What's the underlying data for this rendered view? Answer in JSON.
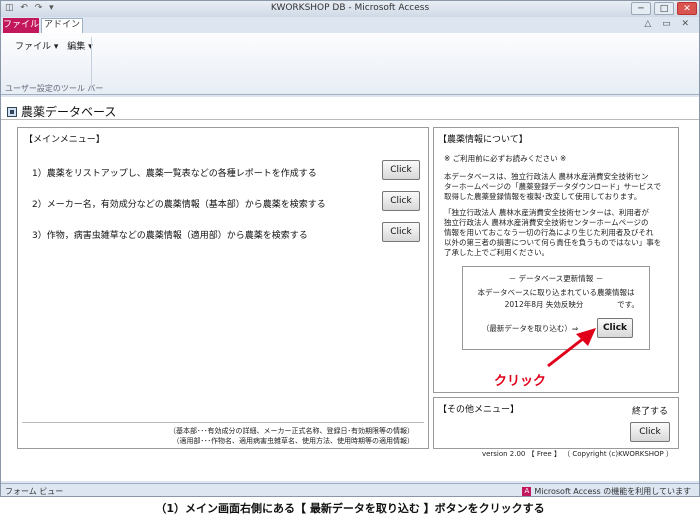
{
  "window": {
    "qa_toolbar": "◫ ↶ ↷ ▾",
    "title": "KWORKSHOP DB - Microsoft Access",
    "ctl": [
      "─",
      "□",
      "✕"
    ]
  },
  "ribbon": {
    "tab_file": "ファイル",
    "tab_addin": "アドイン",
    "right_ctl": "△ ▭ ✕",
    "menus": [
      "ファイル ▾",
      "編集 ▾"
    ],
    "group": "ユーザー設定のツール バー"
  },
  "doc": {
    "title": "農薬データベース"
  },
  "main": {
    "heading": "【メインメニュー】",
    "rows": [
      {
        "text": "1）農薬をリストアップし、農薬一覧表などの各種レポートを作成する",
        "button": "Click"
      },
      {
        "text": "2）メーカー名，有効成分などの農薬情報（基本部）から農薬を検索する",
        "button": "Click"
      },
      {
        "text": "3）作物，病害虫雑草などの農薬情報（適用部）から農薬を検索する",
        "button": "Click"
      }
    ],
    "footnote1": "（基本部･･･有効成分の詳細、メーカー正式名称、登録日･有効期限等の情報）",
    "footnote2": "（適用部･･･作物名、適用病害虫雑草名、使用方法、使用時期等の適用情報）"
  },
  "info": {
    "heading": "【農薬情報について】",
    "notice": "※ ご利用前に必ずお読みください ※",
    "p1": [
      "本データベースは、独立行政法人 農林水産消費安全技術セン",
      "ターホームページの「農薬登録データダウンロード」サービスで",
      "取得した農薬登録情報を複製･改変して使用しております。"
    ],
    "p2": [
      "「独立行政法人 農林水産消費安全技術センターは、利用者が",
      "独立行政法人 農林水産消費安全技術センターホームページの",
      "情報を用いておこなう一切の行為により生じた利用者及びそれ",
      "以外の第三者の損害について何ら責任を負うものではない」事を",
      "了承した上でご利用ください。"
    ],
    "update_title": "－ データベース更新情報 －",
    "update_line1": "本データベースに取り込まれている農薬情報は",
    "update_date": "2012年8月 失効反映分",
    "update_suffix": "です。",
    "import_label": "（最新データを取り込む）⇒",
    "import_button": "Click"
  },
  "other": {
    "heading": "【その他メニュー】",
    "exit_label": "終了する",
    "exit_button": "Click"
  },
  "version": "version 2.00 【 Free 】 （ Copyright (c)KWORKSHOP ）",
  "status": {
    "left": "フォーム ビュー",
    "badge": "A",
    "right": "Microsoft Access の機能を利用しています"
  },
  "annotation": "クリック",
  "caption": "（1）メイン画面右側にある【 最新データを取り込む 】ボタンをクリックする",
  "colors": {
    "accent": "#c2185b",
    "annotation": "#e0001a"
  }
}
